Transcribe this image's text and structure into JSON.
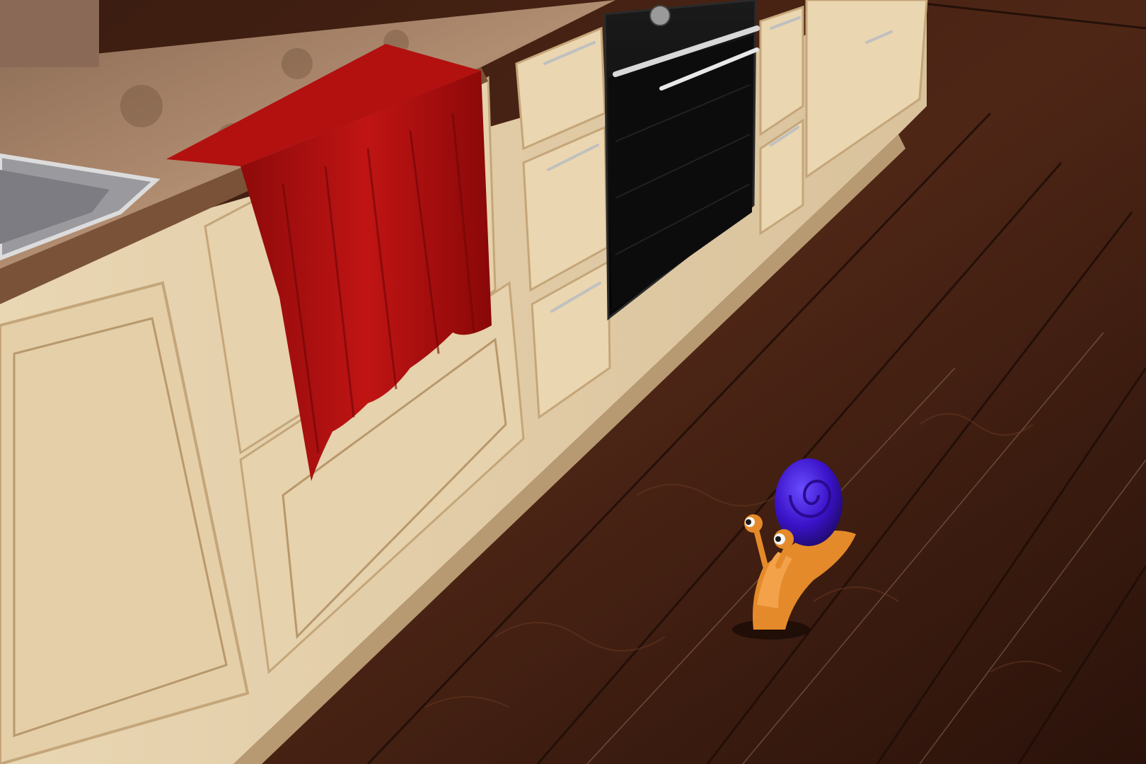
{
  "scene": {
    "palette": {
      "floor_dark": "#2a140c",
      "floor_mid": "#4a2416",
      "floor_light": "#6e3a22",
      "cabinet": "#e8d3ae",
      "cabinet_shadow": "#c9ad82",
      "countertop": "#a07a5c",
      "towel": "#b3100f",
      "towel_dark": "#7a0808",
      "oven_glass": "#121212",
      "steel": "#c8c8c8",
      "snail_body": "#e58a2a",
      "snail_shell": "#3a12c8"
    },
    "objects": [
      {
        "name": "wood-plank-floor",
        "icon": "floor"
      },
      {
        "name": "kitchen-base-cabinets",
        "icon": "cabinet"
      },
      {
        "name": "granite-countertop",
        "icon": "countertop"
      },
      {
        "name": "stainless-sink",
        "icon": "sink"
      },
      {
        "name": "red-towel",
        "icon": "towel"
      },
      {
        "name": "built-in-oven",
        "icon": "oven"
      },
      {
        "name": "toy-snail",
        "icon": "snail"
      }
    ]
  }
}
